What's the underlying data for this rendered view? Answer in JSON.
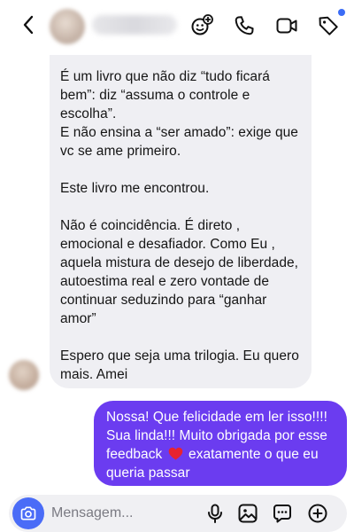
{
  "header": {
    "icons": [
      "back-icon",
      "avatar-sticker-icon",
      "phone-icon",
      "video-icon",
      "tag-icon"
    ],
    "accent_color": "#3b6cf6"
  },
  "received": {
    "paragraphs": [
      "É um livro que não diz “tudo ficará bem”: diz “assuma o controle e escolha”.",
      "E não ensina a “ser amado”: exige que vc se ame primeiro.",
      "Este livro me encontrou.",
      "Não é coincidência. É direto , emocional e desafiador. Como Eu , aquela mistura de desejo de liberdade, autoestima real e zero vontade de continuar seduzindo para “ganhar amor”",
      "Espero que seja uma trilogia. Eu quero mais. Amei"
    ],
    "bubble_color": "#efeff3"
  },
  "sent": {
    "text_before": "Nossa! Que felicidade em ler isso!!!! Sua linda!!! Muito obrigada por esse feedback",
    "text_after": "exatamente o que eu queria passar",
    "heart": "❤️",
    "bubble_color": "#6b3cf0"
  },
  "composer": {
    "placeholder": "Mensagem...",
    "icons": [
      "camera-icon",
      "microphone-icon",
      "gallery-icon",
      "sticker-icon",
      "add-icon"
    ],
    "camera_color": "#4a6cf7"
  }
}
